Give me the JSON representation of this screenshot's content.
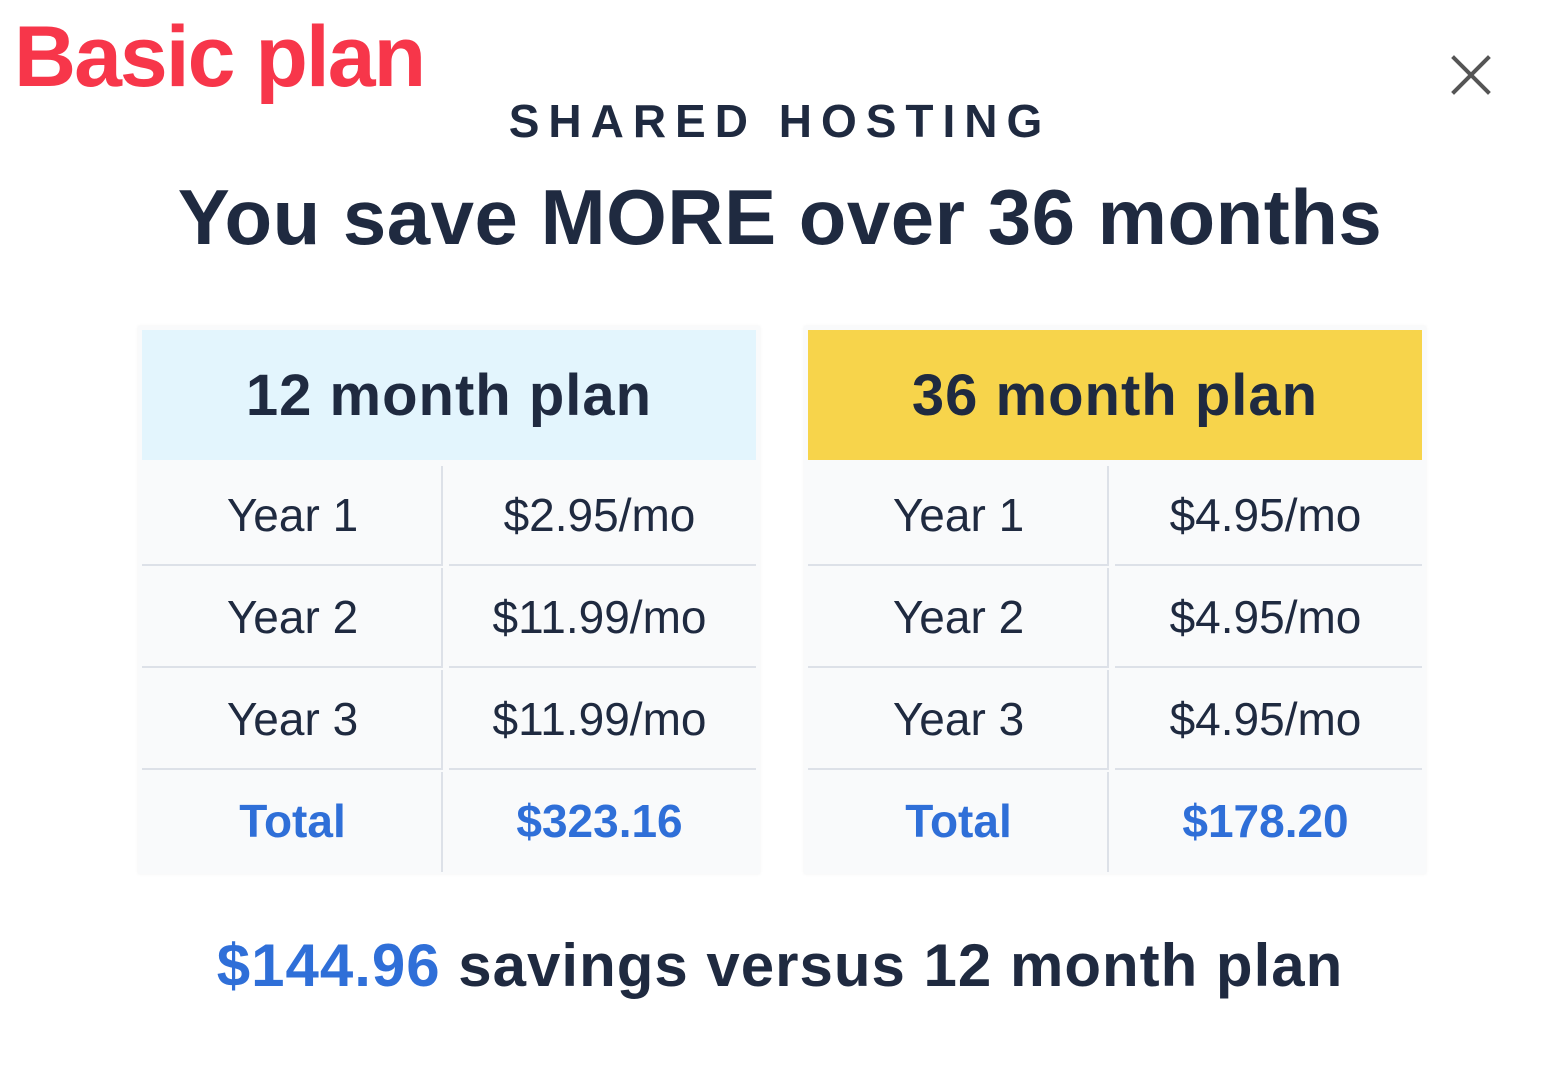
{
  "badge": {
    "label": "Basic plan",
    "color": "#f7364a"
  },
  "dialog": {
    "close_icon": "close-icon",
    "eyebrow": "SHARED HOSTING",
    "headline": "You save MORE over 36 months"
  },
  "plans": [
    {
      "title": "12 month plan",
      "header_color": "#e3f5fd",
      "rows": [
        {
          "label": "Year 1",
          "price": "$2.95/mo"
        },
        {
          "label": "Year 2",
          "price": "$11.99/mo"
        },
        {
          "label": "Year 3",
          "price": "$11.99/mo"
        }
      ],
      "total": {
        "label": "Total",
        "value": "$323.16"
      }
    },
    {
      "title": "36 month plan",
      "header_color": "#f7d44b",
      "rows": [
        {
          "label": "Year 1",
          "price": "$4.95/mo"
        },
        {
          "label": "Year 2",
          "price": "$4.95/mo"
        },
        {
          "label": "Year 3",
          "price": "$4.95/mo"
        }
      ],
      "total": {
        "label": "Total",
        "value": "$178.20"
      }
    }
  ],
  "savings": {
    "amount": "$144.96",
    "text": " savings versus 12 month plan"
  },
  "colors": {
    "text": "#1f2a40",
    "accent_blue": "#2f6fd8"
  }
}
